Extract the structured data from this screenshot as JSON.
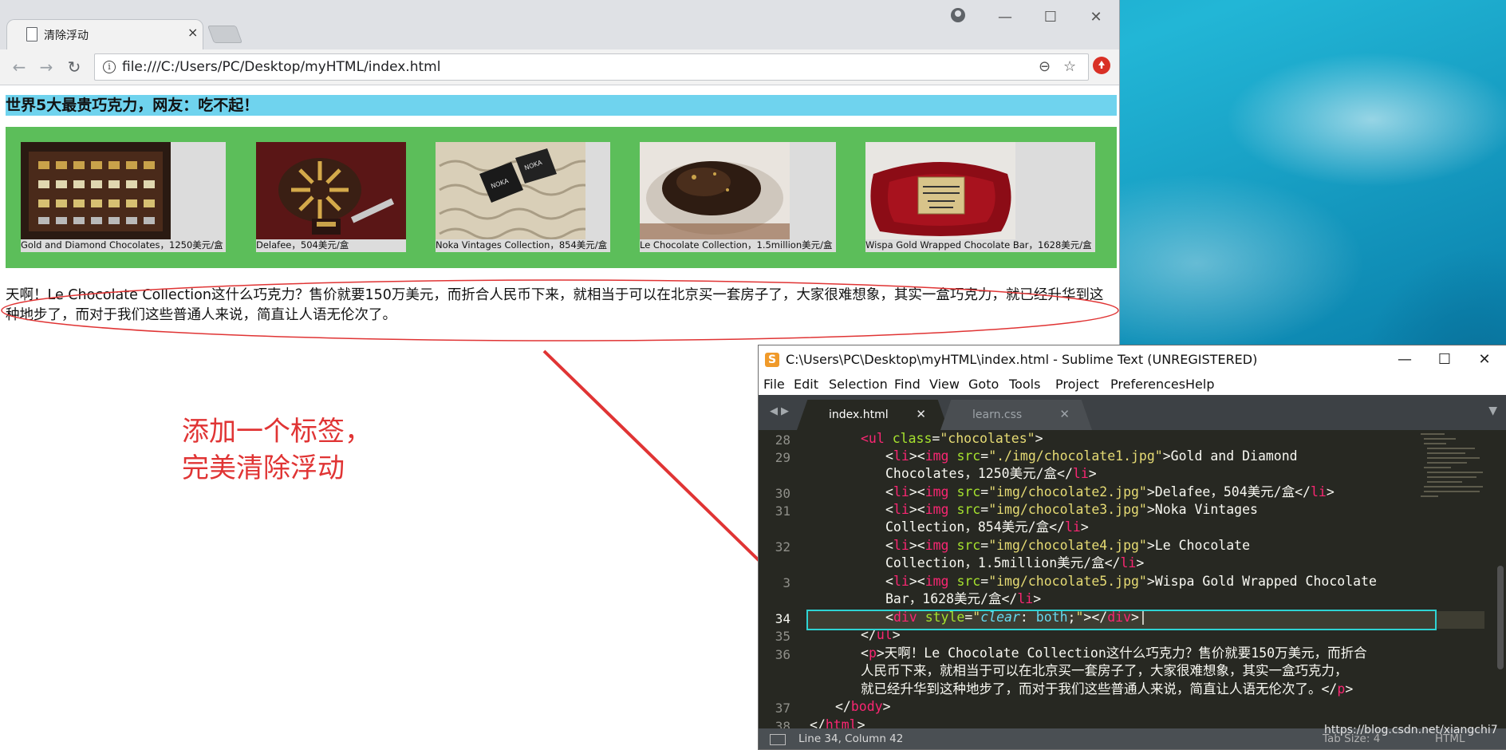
{
  "browser": {
    "tab_title": "清除浮动",
    "tab_close": "×",
    "url": "file:///C:/Users/PC/Desktop/myHTML/index.html",
    "window_controls": {
      "minimize": "—",
      "maximize": "☐",
      "close": "✕"
    }
  },
  "page": {
    "heading": "世界5大最贵巧克力，网友：吃不起！",
    "chocolates": [
      {
        "caption": "Gold and Diamond Chocolates，1250美元/盒"
      },
      {
        "caption": "Delafee，504美元/盒"
      },
      {
        "caption": "Noka Vintages Collection，854美元/盒"
      },
      {
        "caption": "Le Chocolate Collection，1.5million美元/盒"
      },
      {
        "caption": "Wispa Gold Wrapped Chocolate Bar，1628美元/盒"
      }
    ],
    "paragraph": "天啊！Le Chocolate Collection这什么巧克力？售价就要150万美元，而折合人民币下来，就相当于可以在北京买一套房子了，大家很难想象，其实一盒巧克力，就已经升华到这种地步了，而对于我们这些普通人来说，简直让人语无伦次了。"
  },
  "annotation": {
    "line1": "添加一个标签，",
    "line2": "完美清除浮动",
    "color": "#e03434"
  },
  "sublime": {
    "title": "C:\\Users\\PC\\Desktop\\myHTML\\index.html - Sublime Text (UNREGISTERED)",
    "window_controls": {
      "minimize": "—",
      "maximize": "☐",
      "close": "✕"
    },
    "menu": [
      "File",
      "Edit",
      "Selection",
      "Find",
      "View",
      "Goto",
      "Tools",
      "Project",
      "Preferences",
      "Help"
    ],
    "tabs": [
      {
        "label": "index.html",
        "active": true
      },
      {
        "label": "learn.css",
        "active": false
      }
    ],
    "line_numbers": [
      "28",
      "29",
      "",
      "30",
      "31",
      "",
      "32",
      "",
      "3",
      "",
      "34",
      "35",
      "36",
      "",
      "",
      "37",
      "38"
    ],
    "status": {
      "position": "Line 34, Column 42",
      "tab_size": "Tab Size: 4",
      "syntax": "HTML"
    }
  },
  "watermark": "https://blog.csdn.net/xiangchi7"
}
